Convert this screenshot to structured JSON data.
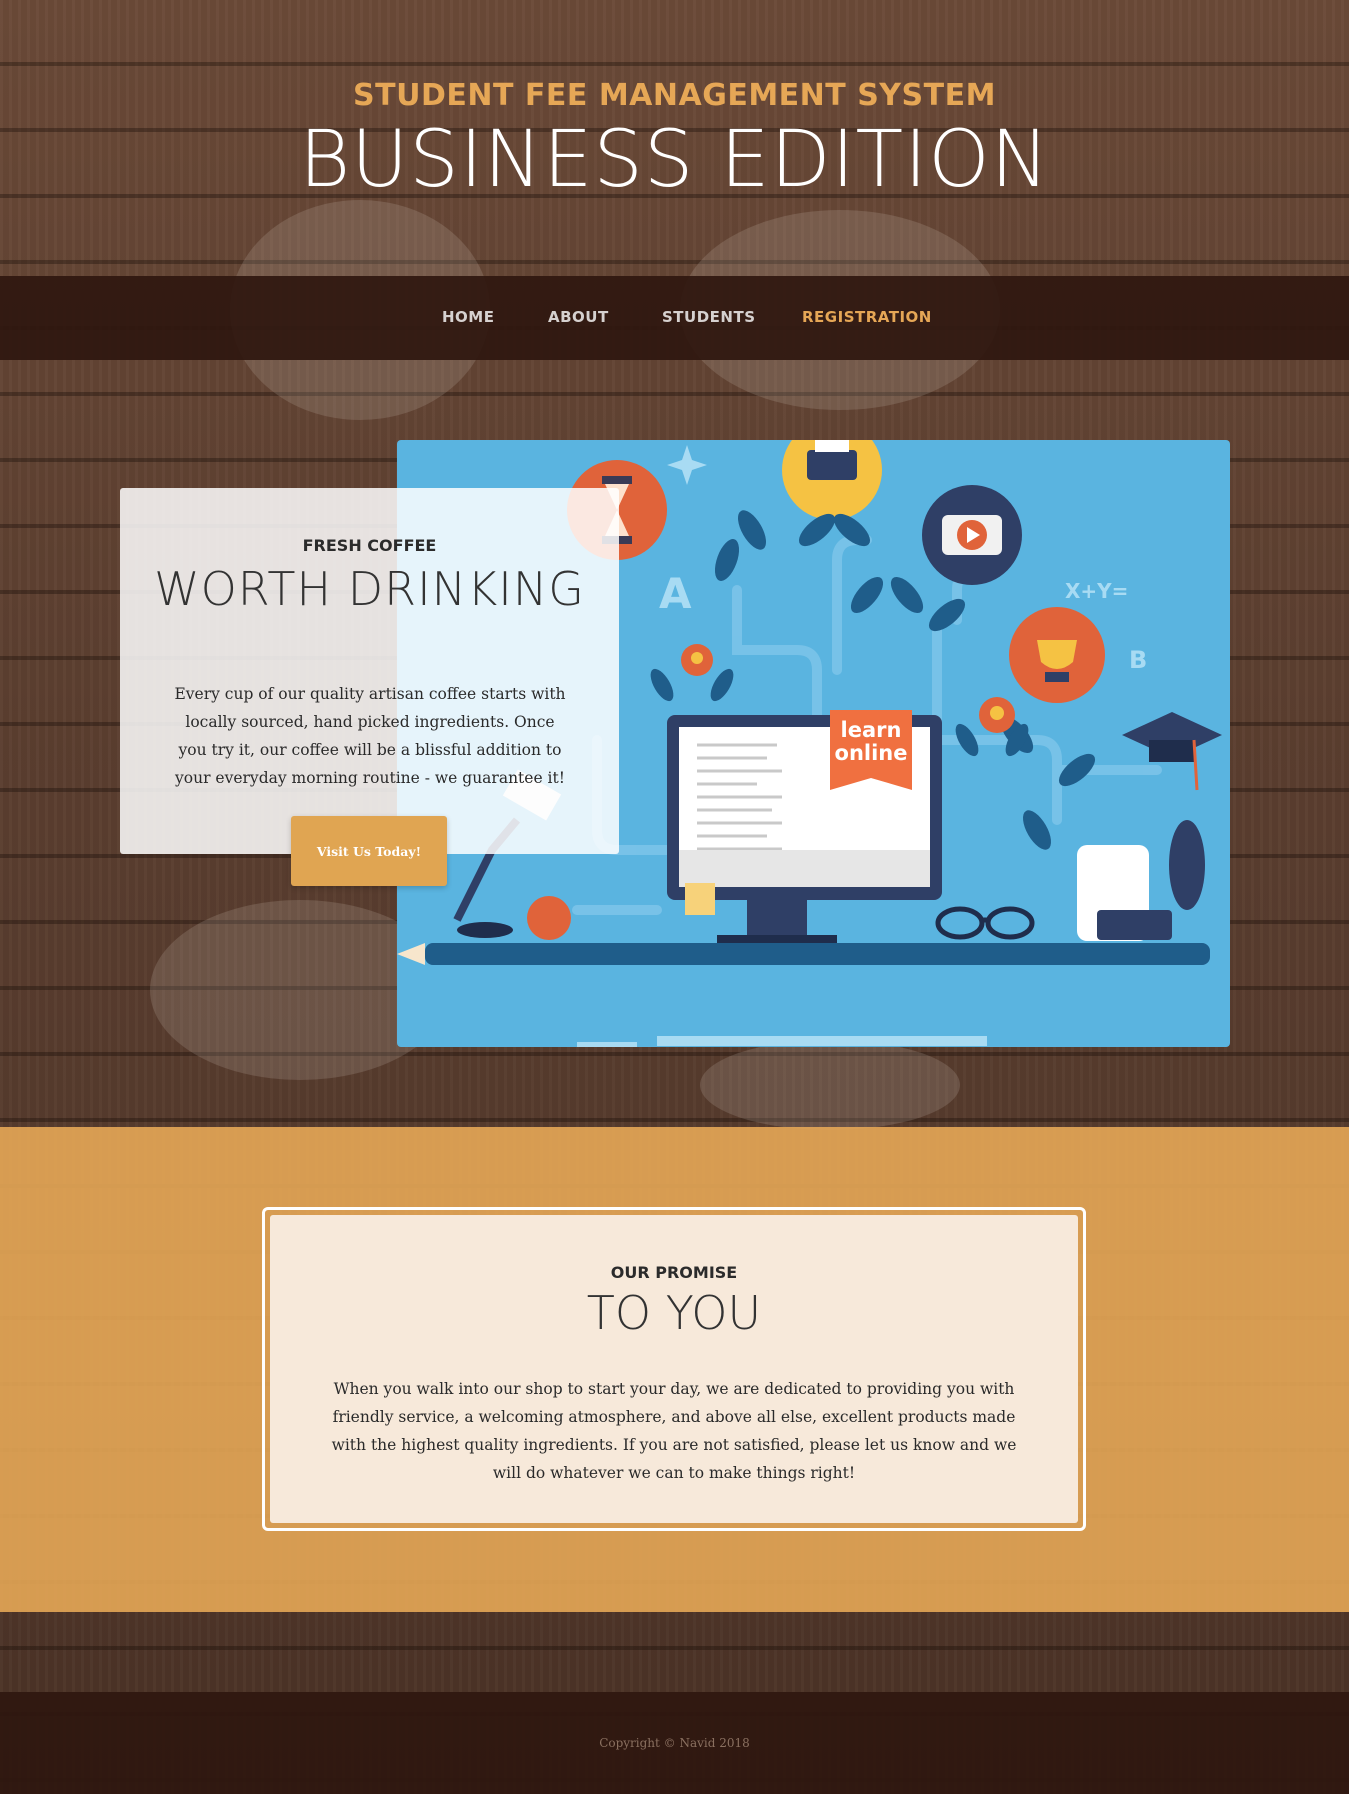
{
  "header": {
    "upper": "STUDENT FEE MANAGEMENT SYSTEM",
    "lower": "BUSINESS EDITION"
  },
  "nav": {
    "items": [
      {
        "label": "HOME"
      },
      {
        "label": "ABOUT"
      },
      {
        "label": "STUDENTS"
      },
      {
        "label": "REGISTRATION"
      }
    ],
    "active": "REGISTRATION"
  },
  "feature": {
    "image_text": {
      "badge": [
        "learn",
        "online"
      ],
      "letters": [
        "A",
        "B"
      ],
      "formula": "X+Y="
    },
    "card": {
      "upper": "FRESH COFFEE",
      "lower": "WORTH DRINKING",
      "text": "Every cup of our quality artisan coffee starts with locally sourced, hand picked ingredients. Once you try it, our coffee will be a blissful addition to your everyday morning routine - we guarantee it!",
      "button": "Visit Us Today!"
    }
  },
  "promise": {
    "upper": "OUR PROMISE",
    "lower": "TO YOU",
    "text": "When you walk into our shop to start your day, we are dedicated to providing you with friendly service, a welcoming atmosphere, and above all else, excellent products made with the highest quality ingredients. If you are not satisfied, please let us know and we will do whatever we can to make things right!"
  },
  "footer": {
    "copyright": "Copyright © Navid 2018"
  },
  "colors": {
    "accent": "#e6a756",
    "nav_bg": "#2f170f",
    "image_bg": "#5ab4e0",
    "button": "#e0a552"
  }
}
